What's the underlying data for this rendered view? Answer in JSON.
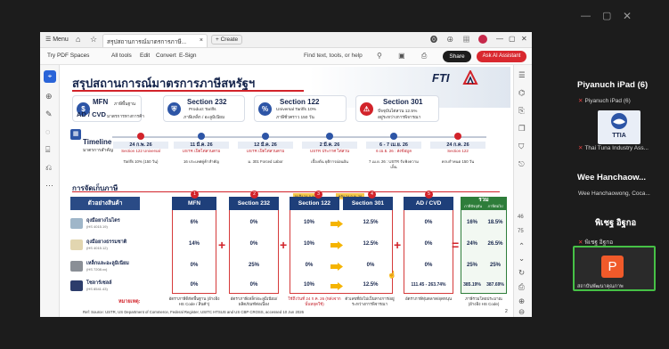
{
  "window": {
    "min": "—",
    "max": "▢",
    "close": "✕"
  },
  "acrobat": {
    "menu": "☰ Menu",
    "home_icon": "⌂",
    "star_icon": "☆",
    "tab_title": "สรุปสถานการณ์มาตรการภาษี...",
    "tab_close": "×",
    "create": "+ Create",
    "top_icons": "⓿ ⊕ ▦",
    "toolbar": {
      "spaces": "Try PDF Spaces",
      "all_tools": "All tools",
      "edit": "Edit",
      "convert": "Convert",
      "esign": "E-Sign",
      "search": "Find text, tools, or help",
      "share": "Share",
      "ai": "Ask AI Assistant"
    },
    "page_controls": [
      "46",
      "75"
    ]
  },
  "doc": {
    "title": "สรุปสถานการณ์มาตรการภาษีสหรัฐฯ",
    "logo": "FTI",
    "cards": [
      {
        "icon": "$",
        "heading": "MFN",
        "sub1": "ภาษีพื้นฐาน",
        "sub2": "",
        "color": "#2d55a6"
      },
      {
        "icon": "",
        "heading": "AD / CVD",
        "sub1": "มาตรการทางการค้า",
        "sub2": "",
        "color": "#2d55a6"
      },
      {
        "icon": "⛨",
        "heading": "Section 232",
        "sub1": "Product Tariffs",
        "sub2": "ภาษีเหล็ก / อะลูมิเนียม",
        "color": "#2d55a6"
      },
      {
        "icon": "%",
        "heading": "Section 122",
        "sub1": "Universal Tariffs 10%",
        "sub2": "ภาษีชั่วคราว 150 วัน",
        "color": "#2d55a6"
      },
      {
        "icon": "⚠",
        "heading": "Section 301",
        "sub1": "ปัจจุบันไต่สวน 12.5%",
        "sub2": "อยู่ระหว่างการพิจารณา",
        "color": "#d2232a"
      }
    ],
    "timeline": {
      "title": "Timeline",
      "subtitle": "มาตรการสำคัญ",
      "first_desc": "Section 122 Universal Tariffs 10% (150 วัน)",
      "first_desc2": "ประกาศมีผลตั้งแต่ 24 ก.พ. 2569",
      "events": [
        {
          "date": "24 ก.พ. 26",
          "title": "Section 122 Universal",
          "desc": "Tariffs 10% (150 วัน)",
          "red": true
        },
        {
          "date": "11 มี.ค. 26",
          "title": "USTR เปิดไต่สวนตาม",
          "desc": "16 ประเทศคู่ค้าสำคัญ",
          "red": false
        },
        {
          "date": "12 มี.ค. 26",
          "title": "USTR เปิดไต่สวนตาม",
          "desc": "ม. 301 Forced Labor",
          "red": false
        },
        {
          "date": "2 มี.ค. 26",
          "title": "USTR ประกาศ ไต่สวน",
          "desc": "เบื้องต้น ยุติการผ่อนผัน",
          "red": false
        },
        {
          "date": "6 - 7 เม.ย. 26",
          "title": "6 เม.ย. 26 : ส่งข้อมูล",
          "desc": "7 เม.ย. 26 : USTR รับฟังความเห็น",
          "red": false
        },
        {
          "date": "24 ก.ค. 26",
          "title": "Section 122",
          "desc": "ครบกำหนด 150 วัน",
          "red": false
        }
      ]
    },
    "section": {
      "title": "การจัดเก็บภาษี",
      "headers": [
        "ตัวอย่างสินค้า",
        "MFN",
        "Section 232",
        "Section 122",
        "Section 301",
        "AD / CVD",
        "รวม"
      ],
      "total_sub": [
        "ภาษีปัจจุบัน",
        "ภาษีต่อไป"
      ],
      "flags": [
        "จนถึง 24 ก.ค. 26",
        "หลัง 24 ก.ค. 26"
      ],
      "rows": [
        {
          "name": "ถุงมือยางไนไตร",
          "code": "(HS 4015.19)",
          "mfn": "6%",
          "s232": "0%",
          "s122": "10%",
          "s301": "12.5%",
          "adcvd": "0%",
          "t1": "16%",
          "t2": "18.5%",
          "color": "#9fb6c9"
        },
        {
          "name": "ถุงมือยางธรรมชาติ",
          "code": "(HS 4015.12)",
          "mfn": "14%",
          "s232": "0%",
          "s122": "10%",
          "s301": "12.5%",
          "adcvd": "0%",
          "t1": "24%",
          "t2": "26.5%",
          "color": "#e2d6b0"
        },
        {
          "name": "เหล็กและอะลูมิเนียม",
          "code": "(HS 7208.xx)",
          "mfn": "0%",
          "s232": "25%",
          "s122": "0%",
          "s301": "0%",
          "adcvd": "0%",
          "t1": "25%",
          "t2": "25%",
          "color": "#8a8f96"
        },
        {
          "name": "โซลาร์เซลล์",
          "code": "(HS 8541.43)",
          "mfn": "0%",
          "s232": "0%",
          "s122": "10%",
          "s301": "12.5%",
          "adcvd": "111.45 - 263.74%",
          "t1": "385.19%",
          "t2": "387.69%",
          "color": "#2c3d6b"
        }
      ],
      "note_label": "หมายเหตุ:",
      "notes": [
        "อัตราภาษีพิกัดพื้นฐาน (อ้างอิง HS Code / สินค้า)",
        "อัตราภาษีเหล็ก/อะลูมิเนียม/ผลิตภัณฑ์ต่อเนื่อง",
        "ใช้ถึงวันที่ 24 ก.ค. 26 (หลังจากนั้นหยุดใช้)",
        "ตัวเลขที่ยังไม่เป็นทางการ/อยู่ระหว่างการพิจารณา",
        "อัตราภาษีทุ่มตลาด/อุดหนุน",
        "ภาษีรวมโดยประมาณ (อ้างอิง HS Code)"
      ],
      "source": "Ref: Source: USTR, US Department of Commerce, Federal Register, USITC HTSUS and US CBP CROSS, accessed 10 Jun 2026"
    },
    "page": "2"
  },
  "participants": [
    {
      "name": "Piyanuch iPad (6)",
      "sub": "Piyanuch iPad (6)"
    },
    {
      "name": "Thai Tuna Industry Ass...",
      "sub": "Thai Tuna Industry Ass...",
      "logo": "TTIA"
    },
    {
      "name": "Wee Hanchaow...",
      "sub": "Wee Hanchaowong, Coca..."
    },
    {
      "name": "พิเชฐ อิฐกอ",
      "sub": "พิเชฐ อิฐกอ"
    },
    {
      "name": "",
      "sub": "สถาบันพัฒนาคุณภาพ",
      "avatar": "P"
    }
  ],
  "colors": {
    "navy": "#16254c",
    "red": "#d2232a",
    "green": "#2e7d3a",
    "orange": "#f05a2a"
  }
}
